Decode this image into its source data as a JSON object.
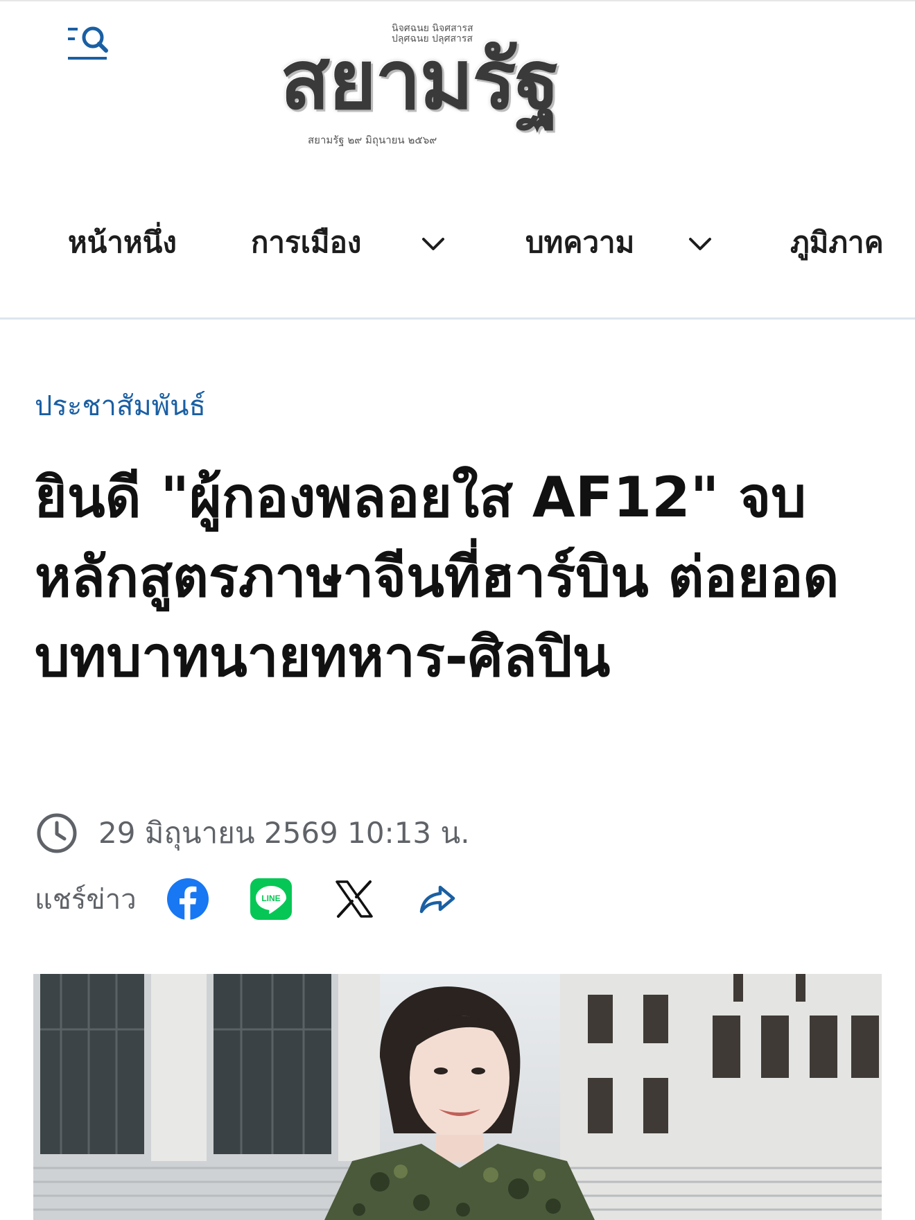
{
  "header": {
    "logo": {
      "name": "สยามรัฐ",
      "tagline_line1": "นิจศฉนย นิจศสารส",
      "tagline_line2": "ปลุศฉนย ปลุศสารส",
      "date_line": "สยามรัฐ  ๒๙ มิถุนายน ๒๕๖๙"
    },
    "menu_search_icon": "menu-search-icon"
  },
  "nav": {
    "items": [
      {
        "label": "หน้าหนึ่ง",
        "has_dropdown": false
      },
      {
        "label": "การเมือง",
        "has_dropdown": true
      },
      {
        "label": "บทความ",
        "has_dropdown": true
      },
      {
        "label": "ภูมิภาค",
        "has_dropdown": false
      }
    ]
  },
  "article": {
    "category": "ประชาสัมพันธ์",
    "headline": "ยินดี \"ผู้กองพลอยใส AF12\" จบหลักสูตรภาษาจีนที่ฮาร์บิน ต่อยอดบทบาทนายทหาร-ศิลปิน",
    "published": "29 มิถุนายน 2569 10:13 น.",
    "share": {
      "label": "แชร์ข่าว",
      "buttons": [
        {
          "name": "facebook",
          "icon": "facebook-icon",
          "color": "#1877f2"
        },
        {
          "name": "line",
          "icon": "line-icon",
          "color": "#06c755",
          "text": "LINE"
        },
        {
          "name": "x",
          "icon": "x-icon",
          "color": "#111111"
        },
        {
          "name": "share",
          "icon": "share-arrow-icon",
          "color": "#1a5fa3"
        }
      ]
    }
  },
  "colors": {
    "accent_blue": "#1a5fa3",
    "meta_gray": "#5f6368",
    "divider": "#dde5ee"
  }
}
